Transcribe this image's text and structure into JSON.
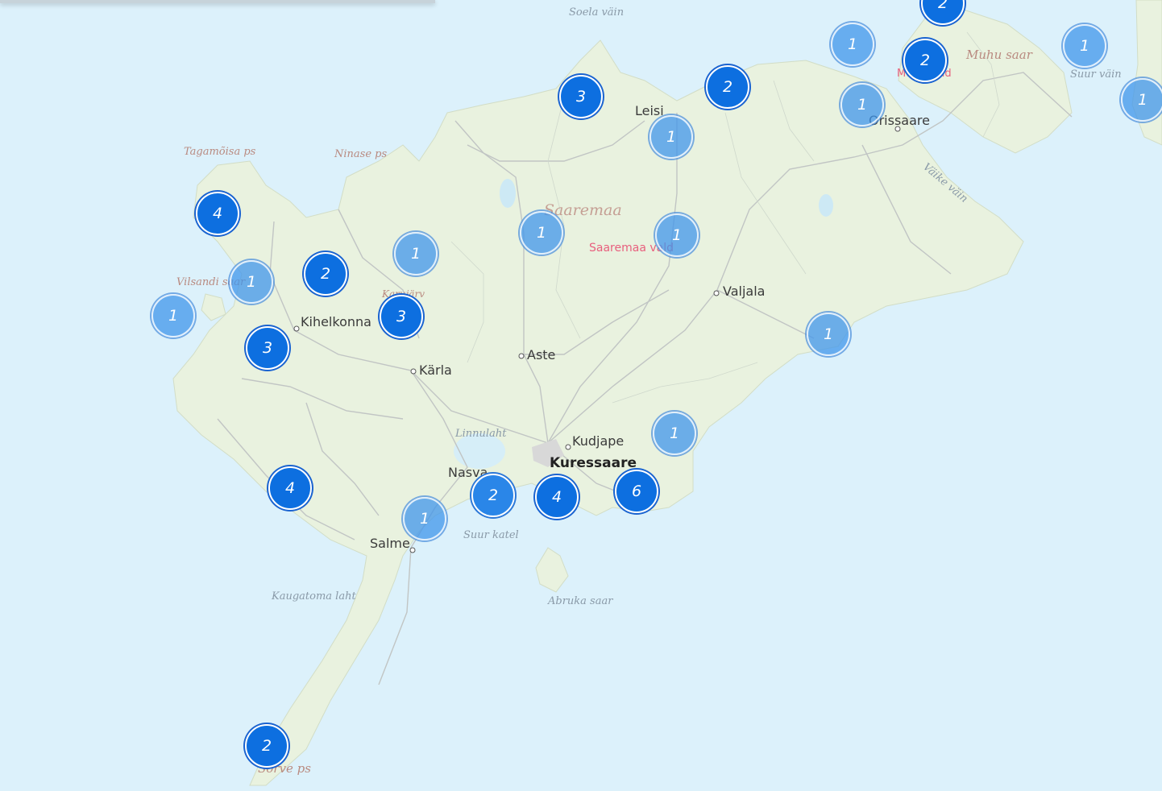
{
  "map": {
    "labels": {
      "soela": "Soela väin",
      "tagamoisa": "Tagamõisa ps",
      "ninase": "Ninase ps",
      "saaremaa": "Saaremaa",
      "saaremaa_vald": "Saaremaa vald",
      "vilsandi": "Vilsandi saar",
      "kihelkonna": "Kihelkonna",
      "karla": "Kärla",
      "aste": "Aste",
      "valjala": "Valjala",
      "leisi": "Leisi",
      "orissaare": "Orissaare",
      "muhu_saar": "Muhu saar",
      "muhu_vald": "Muhu vald",
      "suur_vain": "Suur väin",
      "vaike_vain": "Väike väin",
      "linnulaht": "Linnulaht",
      "kudjape": "Kudjape",
      "kuressaare": "Kuressaare",
      "nasva": "Nasva",
      "salme": "Salme",
      "suur_katel": "Suur katel",
      "abruka": "Abruka saar",
      "kaugatoma": "Kaugatoma laht",
      "sorve": "Sõrve ps",
      "karujarv": "Karujärv"
    },
    "clusters": [
      {
        "id": "c01",
        "count": "2",
        "style": "dark"
      },
      {
        "id": "c02",
        "count": "1",
        "style": "light"
      },
      {
        "id": "c03",
        "count": "2",
        "style": "dark"
      },
      {
        "id": "c04",
        "count": "1",
        "style": "light"
      },
      {
        "id": "c05",
        "count": "3",
        "style": "dark"
      },
      {
        "id": "c06",
        "count": "2",
        "style": "dark"
      },
      {
        "id": "c07",
        "count": "1",
        "style": "light"
      },
      {
        "id": "c08",
        "count": "1",
        "style": "light"
      },
      {
        "id": "c09",
        "count": "1",
        "style": "light"
      },
      {
        "id": "c10",
        "count": "4",
        "style": "dark"
      },
      {
        "id": "c11",
        "count": "1",
        "style": "light"
      },
      {
        "id": "c12",
        "count": "1",
        "style": "light"
      },
      {
        "id": "c13",
        "count": "1",
        "style": "light"
      },
      {
        "id": "c14",
        "count": "2",
        "style": "dark"
      },
      {
        "id": "c15",
        "count": "1",
        "style": "light"
      },
      {
        "id": "c16",
        "count": "1",
        "style": "light"
      },
      {
        "id": "c17",
        "count": "3",
        "style": "dark"
      },
      {
        "id": "c18",
        "count": "3",
        "style": "dark"
      },
      {
        "id": "c19",
        "count": "1",
        "style": "light"
      },
      {
        "id": "c20",
        "count": "1",
        "style": "light"
      },
      {
        "id": "c21",
        "count": "4",
        "style": "dark"
      },
      {
        "id": "c22",
        "count": "2",
        "style": "mid"
      },
      {
        "id": "c23",
        "count": "4",
        "style": "dark"
      },
      {
        "id": "c24",
        "count": "6",
        "style": "dark"
      },
      {
        "id": "c25",
        "count": "1",
        "style": "light"
      },
      {
        "id": "c26",
        "count": "2",
        "style": "dark"
      }
    ],
    "colors": {
      "water": "#dcf1fb",
      "land": "#e9f2df",
      "road": "#b8bcbc",
      "cluster_dark": "#0d6fe0",
      "cluster_light": "#4096eb"
    }
  }
}
